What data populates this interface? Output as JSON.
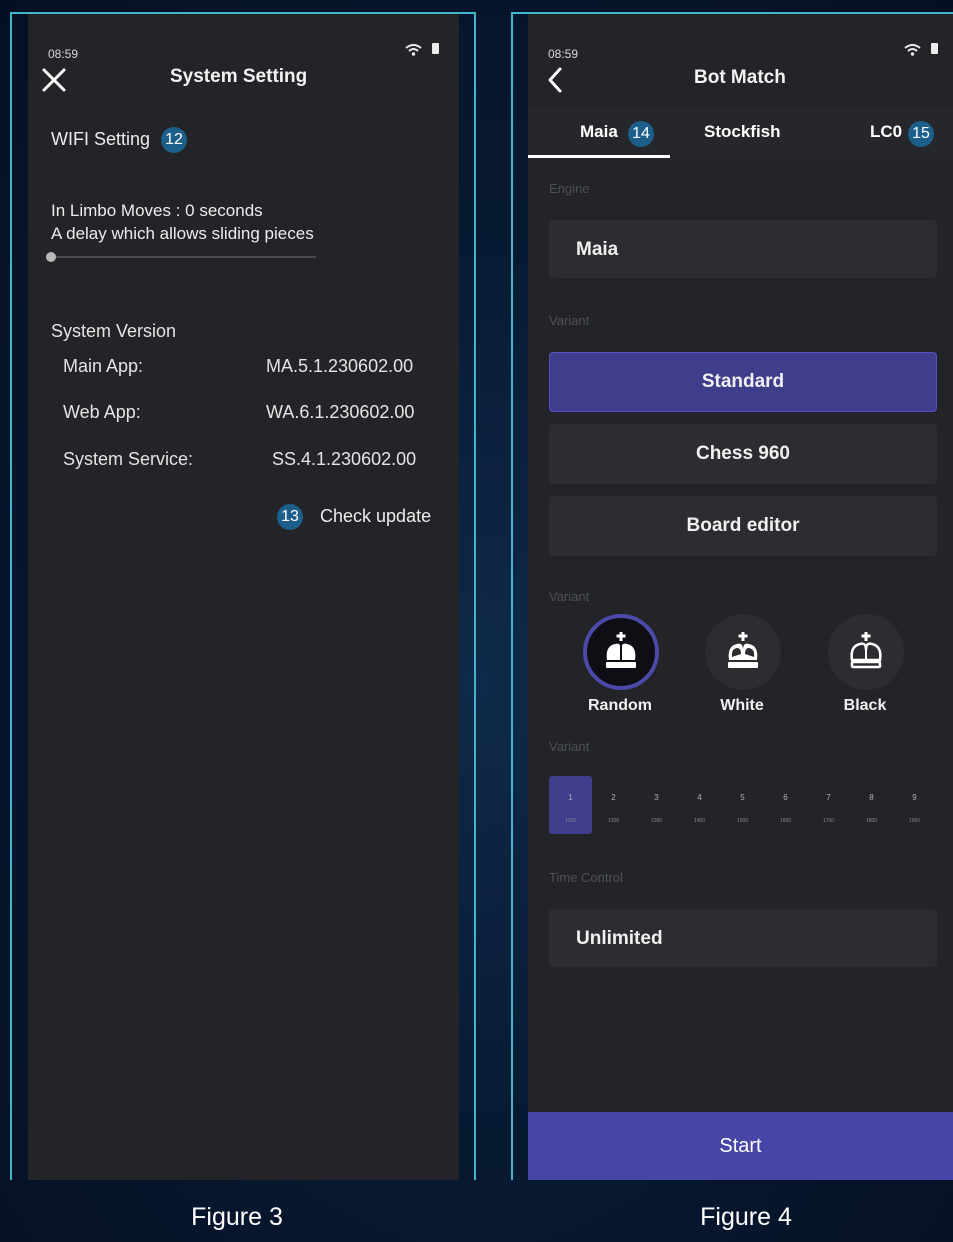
{
  "figure3": {
    "status_time": "08:59",
    "title": "System Setting",
    "wifi_label": "WIFI Setting",
    "wifi_badge": "12",
    "limbo_line1": "In Limbo Moves : 0 seconds",
    "limbo_line2": "A delay which allows sliding pieces",
    "limbo_value_fraction": 0,
    "version_heading": "System Version",
    "versions": [
      {
        "label": "Main App:",
        "value": "MA.5.1.230602.00"
      },
      {
        "label": "Web App:",
        "value": "WA.6.1.230602.00"
      },
      {
        "label": "System Service:",
        "value": "SS.4.1.230602.00"
      }
    ],
    "check_badge": "13",
    "check_label": "Check update",
    "caption": "Figure 3"
  },
  "figure4": {
    "status_time": "08:59",
    "title": "Bot Match",
    "tabs": [
      {
        "label": "Maia",
        "badge": "14",
        "active": true
      },
      {
        "label": "Stockfish",
        "badge": "",
        "active": false
      },
      {
        "label": "LC0",
        "badge": "15",
        "active": false
      }
    ],
    "engine_section_label": "Engine",
    "engine_value": "Maia",
    "variant_section_label": "Variant",
    "variants": [
      {
        "label": "Standard",
        "selected": true
      },
      {
        "label": "Chess 960",
        "selected": false
      },
      {
        "label": "Board editor",
        "selected": false
      }
    ],
    "color_section_label": "Variant",
    "colors": [
      {
        "label": "Random",
        "icon": "random-king-icon",
        "selected": true
      },
      {
        "label": "White",
        "icon": "white-king-icon",
        "selected": false
      },
      {
        "label": "Black",
        "icon": "black-king-icon",
        "selected": false
      }
    ],
    "level_section_label": "Variant",
    "levels": [
      {
        "num": "1",
        "elo": "1100",
        "selected": true
      },
      {
        "num": "2",
        "elo": "1200",
        "selected": false
      },
      {
        "num": "3",
        "elo": "1300",
        "selected": false
      },
      {
        "num": "4",
        "elo": "1400",
        "selected": false
      },
      {
        "num": "5",
        "elo": "1500",
        "selected": false
      },
      {
        "num": "6",
        "elo": "1600",
        "selected": false
      },
      {
        "num": "7",
        "elo": "1700",
        "selected": false
      },
      {
        "num": "8",
        "elo": "1800",
        "selected": false
      },
      {
        "num": "9",
        "elo": "1900",
        "selected": false
      }
    ],
    "time_section_label": "Time Control",
    "time_value": "Unlimited",
    "start_label": "Start",
    "caption": "Figure 4"
  },
  "colors": {
    "accent": "#4b4aa8",
    "panel": "#232428",
    "field": "#2c2d31",
    "badge": "#1d5f8b",
    "frame": "#3fb6c9"
  }
}
